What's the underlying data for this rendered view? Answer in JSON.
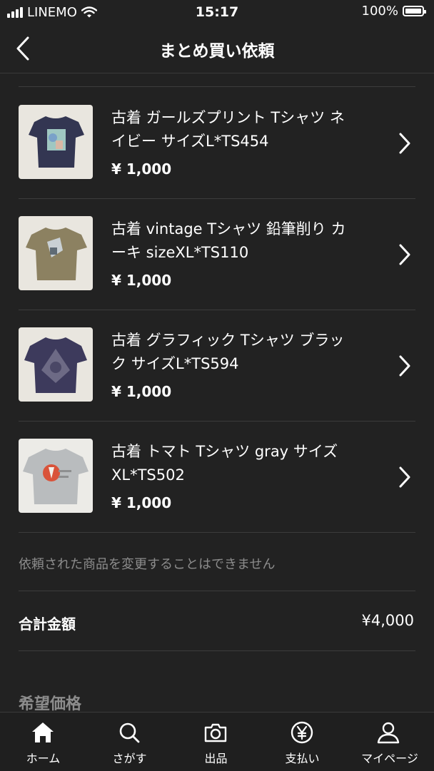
{
  "status_bar": {
    "carrier": "LINEMO",
    "time": "15:17",
    "battery": "100%"
  },
  "nav": {
    "title": "まとめ買い依頼"
  },
  "items": [
    {
      "title_line1": "古着 ガールズプリント Tシャツ ネ",
      "title_line2": "イビー サイズL*TS454",
      "price": "¥ 1,000"
    },
    {
      "title_line1": "古着 vintage Tシャツ 鉛筆削り カ",
      "title_line2": "ーキ sizeXL*TS110",
      "price": "¥ 1,000"
    },
    {
      "title_line1": "古着 グラフィック Tシャツ ブラッ",
      "title_line2": "ク サイズL*TS594",
      "price": "¥ 1,000"
    },
    {
      "title_line1": "古着 トマト Tシャツ gray サイズ",
      "title_line2": "XL*TS502",
      "price": "¥ 1,000"
    }
  ],
  "notice": "依頼された商品を変更することはできません",
  "total": {
    "label": "合計金額",
    "value": "¥4,000"
  },
  "hope_price": {
    "label": "希望価格"
  },
  "tabs": [
    {
      "label": "ホーム",
      "icon": "home-icon"
    },
    {
      "label": "さがす",
      "icon": "search-icon"
    },
    {
      "label": "出品",
      "icon": "camera-icon"
    },
    {
      "label": "支払い",
      "icon": "yen-icon"
    },
    {
      "label": "マイページ",
      "icon": "person-icon"
    }
  ],
  "colors": {
    "background": "#222222",
    "divider": "#3c3c3c",
    "muted_text": "#8c8c8c"
  }
}
